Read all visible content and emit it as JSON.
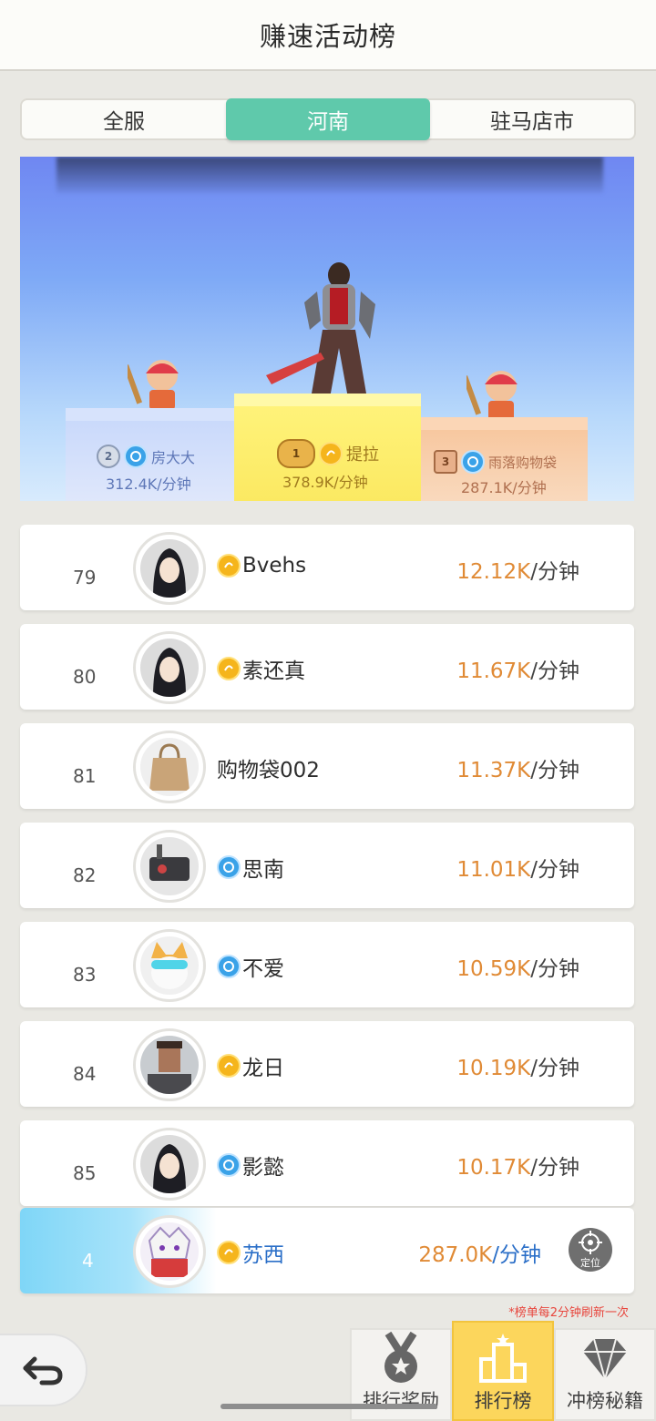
{
  "header": {
    "title": "赚速活动榜"
  },
  "tabs": [
    {
      "label": "全服",
      "active": false
    },
    {
      "label": "河南",
      "active": true
    },
    {
      "label": "驻马店市",
      "active": false
    }
  ],
  "podium": {
    "second": {
      "rank": "2",
      "name": "房大大",
      "score": "312.4K/分钟",
      "badge": "blue"
    },
    "first": {
      "rank": "1",
      "name": "提拉",
      "score": "378.9K/分钟",
      "badge": "gold"
    },
    "third": {
      "rank": "3",
      "name": "雨落购物袋",
      "score": "287.1K/分钟",
      "badge": "blue"
    }
  },
  "rows": [
    {
      "rank": "79",
      "name": "Bvehs",
      "score_num": "12.12K",
      "unit": "/分钟",
      "badge": "gold",
      "avatar": "warrior-avatar"
    },
    {
      "rank": "80",
      "name": "素还真",
      "score_num": "11.67K",
      "unit": "/分钟",
      "badge": "gold",
      "avatar": "warrior-avatar"
    },
    {
      "rank": "81",
      "name": "购物袋002",
      "score_num": "11.37K",
      "unit": "/分钟",
      "badge": "none",
      "avatar": "bag-avatar"
    },
    {
      "rank": "82",
      "name": "思南",
      "score_num": "11.01K",
      "unit": "/分钟",
      "badge": "blue",
      "avatar": "robot-avatar"
    },
    {
      "rank": "83",
      "name": "不爱",
      "score_num": "10.59K",
      "unit": "/分钟",
      "badge": "blue",
      "avatar": "cat-avatar"
    },
    {
      "rank": "84",
      "name": "龙日",
      "score_num": "10.19K",
      "unit": "/分钟",
      "badge": "gold",
      "avatar": "man-avatar"
    },
    {
      "rank": "85",
      "name": "影懿",
      "score_num": "10.17K",
      "unit": "/分钟",
      "badge": "blue",
      "avatar": "warrior-avatar"
    }
  ],
  "me": {
    "rank": "4",
    "name": "苏西",
    "score_num": "287.0K",
    "unit": "/分钟",
    "locate_label": "定位"
  },
  "note": "*榜单每2分钟刷新一次",
  "bottom_tabs": [
    {
      "label": "排行奖励",
      "icon": "medal-icon"
    },
    {
      "label": "排行榜",
      "icon": "podium-icon",
      "active": true
    },
    {
      "label": "冲榜秘籍",
      "icon": "diamond-icon"
    }
  ],
  "colors": {
    "accent": "#5fc9ab",
    "score": "#e08a35",
    "me_blue": "#2b6fc8",
    "active_tab": "#fcd65c"
  }
}
